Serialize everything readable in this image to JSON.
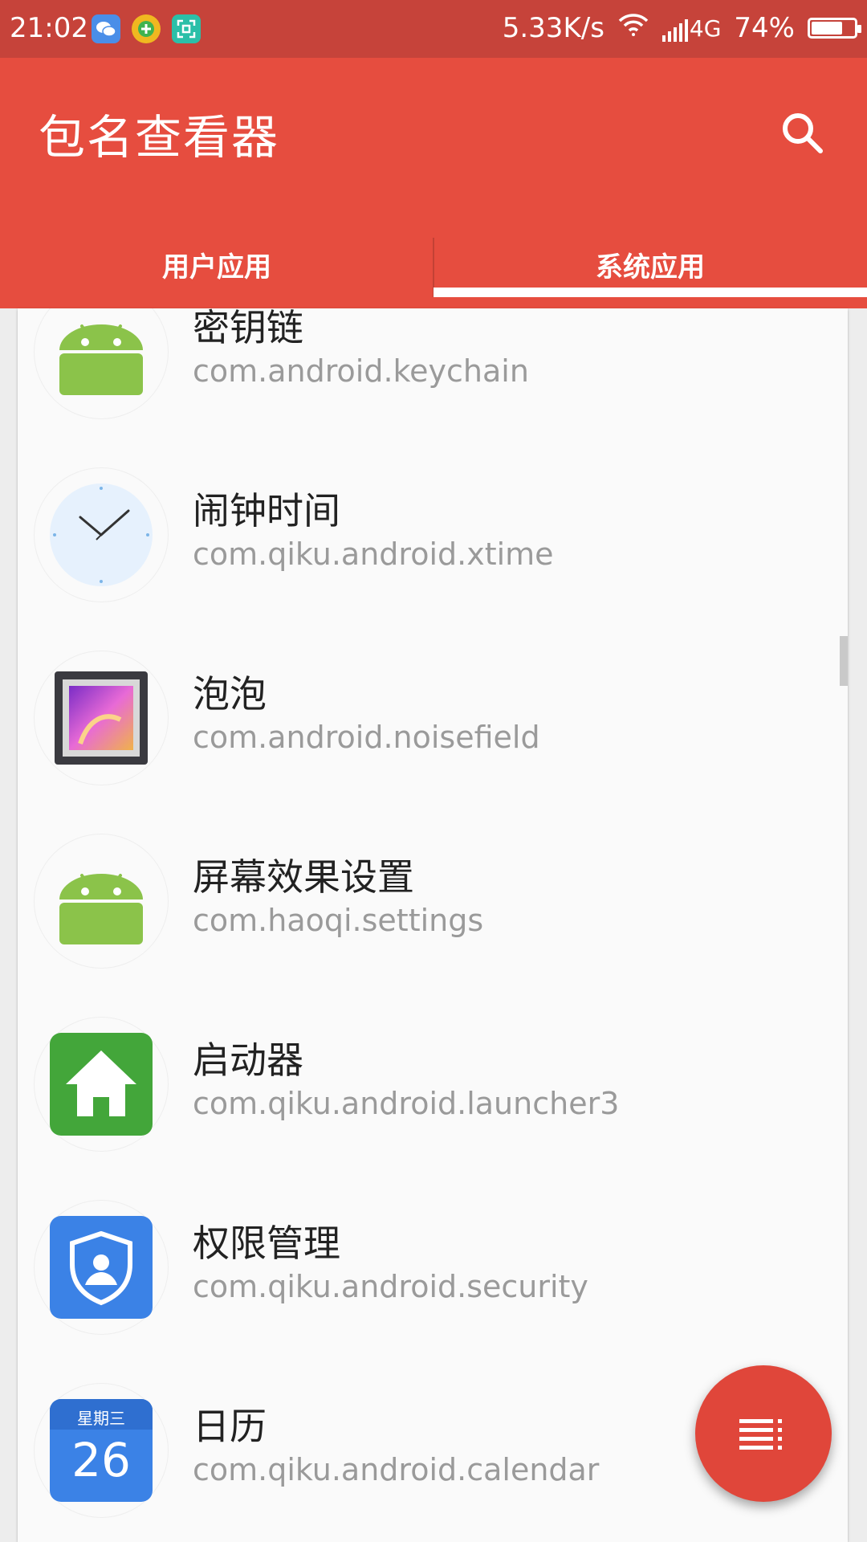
{
  "status_bar": {
    "time": "21:02",
    "speed": "5.33K/s",
    "network": "4G",
    "battery": "74%",
    "battery_level": 0.74,
    "notification_icons": [
      "wechat-icon",
      "360-plus-icon",
      "screenshot-icon"
    ]
  },
  "app_bar": {
    "title": "包名查看器",
    "search_icon": "search-icon",
    "color": "#e64d3f"
  },
  "tabs": [
    {
      "label": "用户应用",
      "selected": false
    },
    {
      "label": "系统应用",
      "selected": true
    }
  ],
  "apps": [
    {
      "name": "密钥链",
      "package": "com.android.keychain",
      "icon": "android-robot-icon"
    },
    {
      "name": "闹钟时间",
      "package": "com.qiku.android.xtime",
      "icon": "clock-icon"
    },
    {
      "name": "泡泡",
      "package": "com.android.noisefield",
      "icon": "picture-frame-icon"
    },
    {
      "name": "屏幕效果设置",
      "package": "com.haoqi.settings",
      "icon": "android-robot-icon"
    },
    {
      "name": "启动器",
      "package": "com.qiku.android.launcher3",
      "icon": "home-icon"
    },
    {
      "name": "权限管理",
      "package": "com.qiku.android.security",
      "icon": "shield-user-icon"
    },
    {
      "name": "日历",
      "package": "com.qiku.android.calendar",
      "icon": "calendar-icon",
      "calendar_weekday": "星期三",
      "calendar_day": "26"
    }
  ],
  "fab": {
    "icon": "menu-list-icon",
    "color": "#e0463a"
  }
}
